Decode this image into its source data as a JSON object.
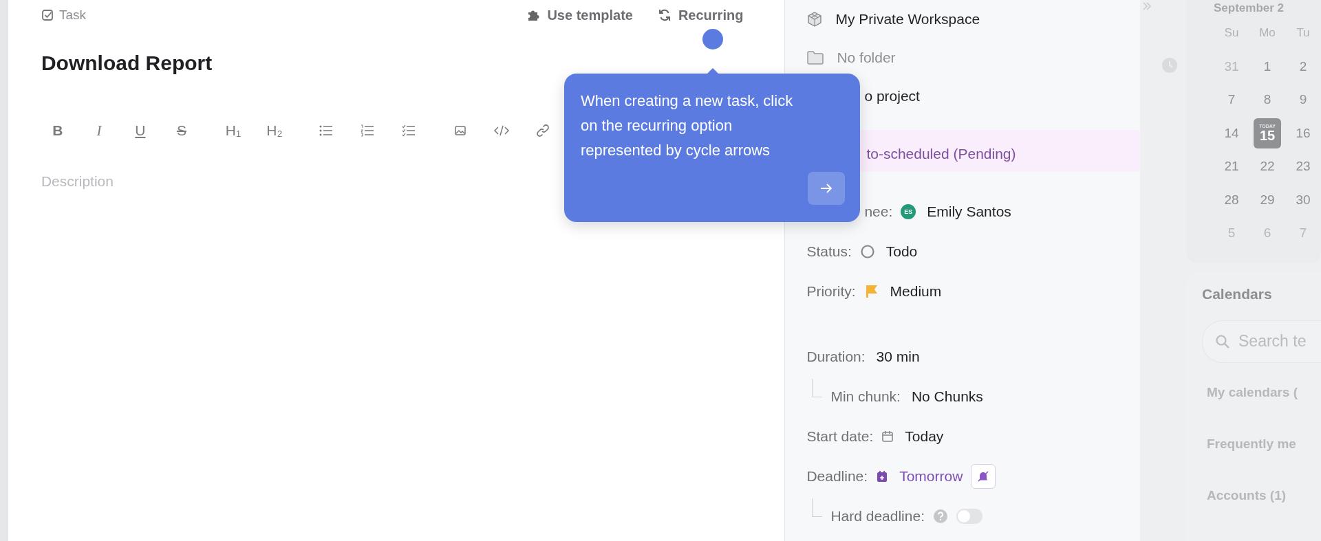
{
  "editor": {
    "task_type": "Task",
    "actions": [
      {
        "kind": "template",
        "label": "Use template"
      },
      {
        "kind": "recurring",
        "label": "Recurring"
      }
    ],
    "title": "Download Report",
    "toolbar": [
      {
        "kind": "bold",
        "label": "B"
      },
      {
        "kind": "italic",
        "label": "I"
      },
      {
        "kind": "underline",
        "label": "U"
      },
      {
        "kind": "strike",
        "label": "S"
      },
      {
        "kind": "h1",
        "label": "H₁"
      },
      {
        "kind": "h2",
        "label": "H₂"
      },
      {
        "kind": "bullets"
      },
      {
        "kind": "numbers"
      },
      {
        "kind": "checklist"
      },
      {
        "kind": "image"
      },
      {
        "kind": "code"
      },
      {
        "kind": "link"
      }
    ],
    "description_placeholder": "Description"
  },
  "tooltip": {
    "text": "When creating a new task, click on the recurring option represented by cycle arrows"
  },
  "details": {
    "location": [
      {
        "kind": "workspace",
        "text": "My Private Workspace"
      },
      {
        "kind": "folder",
        "text": "No folder"
      },
      {
        "kind": "project",
        "text": "o project"
      }
    ],
    "schedule_status": "to-scheduled (Pending)",
    "fields": [
      {
        "kind": "assignee",
        "label": "nee:",
        "value": "Emily Santos",
        "avatar": "ES"
      },
      {
        "kind": "status",
        "label": "Status:",
        "value": "Todo"
      },
      {
        "kind": "priority",
        "label": "Priority:",
        "value": "Medium"
      },
      {
        "kind": "duration",
        "label": "Duration:",
        "value": "30 min"
      },
      {
        "kind": "subfield",
        "label": "Min chunk:",
        "value": "No Chunks"
      },
      {
        "kind": "start",
        "label": "Start date:",
        "value": "Today"
      },
      {
        "kind": "deadline",
        "label": "Deadline:",
        "value": "Tomorrow"
      },
      {
        "kind": "toggle",
        "label": "Hard deadline:",
        "on": false
      }
    ]
  },
  "calendar": {
    "month": "September 2",
    "weekdays": [
      "Su",
      "Mo",
      "Tu"
    ],
    "today_label": "TODAY",
    "weeks": [
      [
        {
          "day": "31",
          "muted": true,
          "today": false
        },
        {
          "day": "1",
          "muted": false,
          "today": false
        },
        {
          "day": "2",
          "muted": false,
          "today": false
        }
      ],
      [
        {
          "day": "7",
          "muted": false,
          "today": false
        },
        {
          "day": "8",
          "muted": false,
          "today": false
        },
        {
          "day": "9",
          "muted": false,
          "today": false
        }
      ],
      [
        {
          "day": "14",
          "muted": false,
          "today": false
        },
        {
          "day": "15",
          "muted": false,
          "today": true
        },
        {
          "day": "16",
          "muted": false,
          "today": false
        }
      ],
      [
        {
          "day": "21",
          "muted": false,
          "today": false
        },
        {
          "day": "22",
          "muted": false,
          "today": false
        },
        {
          "day": "23",
          "muted": false,
          "today": false
        }
      ],
      [
        {
          "day": "28",
          "muted": false,
          "today": false
        },
        {
          "day": "29",
          "muted": false,
          "today": false
        },
        {
          "day": "30",
          "muted": false,
          "today": false
        }
      ],
      [
        {
          "day": "5",
          "muted": true,
          "today": false
        },
        {
          "day": "6",
          "muted": true,
          "today": false
        },
        {
          "day": "7",
          "muted": true,
          "today": false
        }
      ]
    ]
  },
  "calendars_panel": {
    "title": "Calendars",
    "search_placeholder": "Search te",
    "sections": [
      "My calendars (",
      "Frequently me",
      "Accounts (1)"
    ]
  }
}
